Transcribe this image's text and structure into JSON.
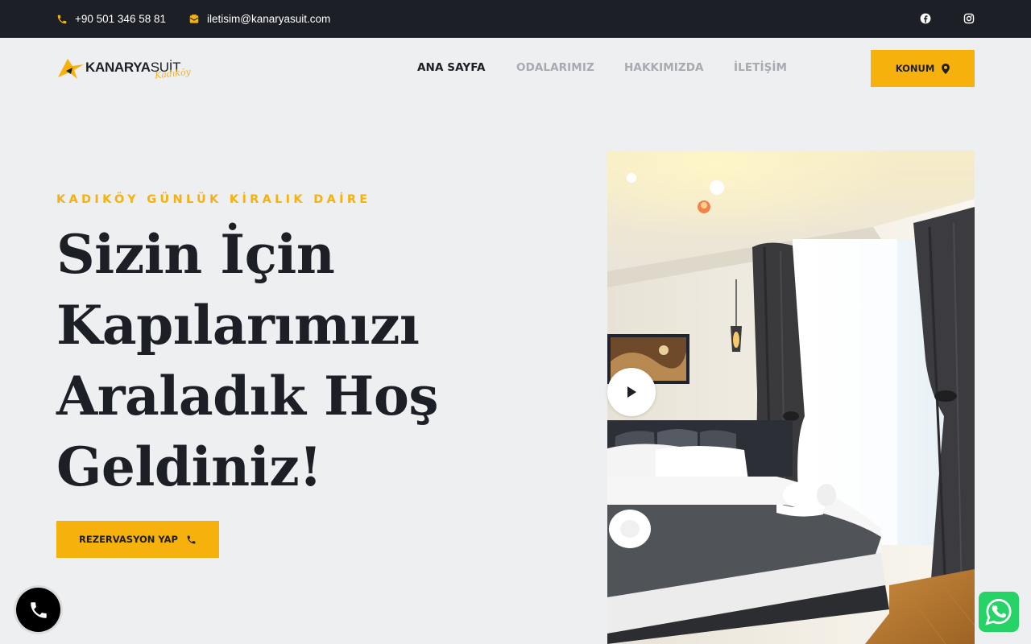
{
  "topbar": {
    "phone": "+90 501 346 58 81",
    "email": "iletisim@kanaryasuit.com",
    "social": [
      "facebook-icon",
      "instagram-icon"
    ]
  },
  "logo": {
    "brand": "KANARYA",
    "brand_suffix": "SUİT",
    "script": "Kadıköy"
  },
  "nav": {
    "items": [
      {
        "label": "ANA SAYFA",
        "active": true
      },
      {
        "label": "ODALARIMIZ",
        "active": false
      },
      {
        "label": "HAKKIMIZDA",
        "active": false
      },
      {
        "label": "İLETİŞİM",
        "active": false
      }
    ]
  },
  "header_button": {
    "label": "KONUM",
    "icon": "map-pin-icon"
  },
  "hero": {
    "eyebrow": "KADIKÖY GÜNLÜK KİRALIK DAİRE",
    "headline_lines": [
      "Sizin İçin",
      "Kapılarımızı",
      "Araladık Hoş",
      "Geldiniz!"
    ],
    "cta_label": "REZERVASYON YAP",
    "cta_icon": "phone-icon",
    "image": "bedroom-photo",
    "play_icon": "play-icon"
  },
  "floating": {
    "call_icon": "phone-icon",
    "whatsapp_icon": "whatsapp-icon"
  },
  "colors": {
    "accent": "#f6b10d",
    "dark": "#1c1f26",
    "background": "#eeeff1",
    "nav_inactive": "#a7aab0",
    "whatsapp": "#25d366"
  }
}
